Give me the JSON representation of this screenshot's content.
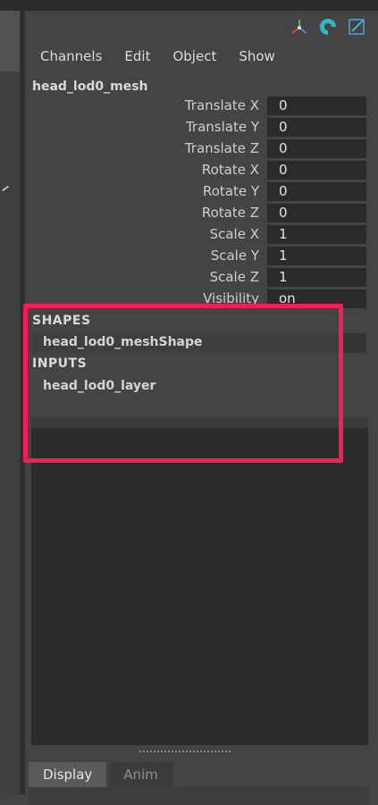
{
  "toolbar": {
    "icons": [
      "axis-tripod-icon",
      "refresh-icon",
      "edit-pencil-icon"
    ]
  },
  "menu": [
    "Channels",
    "Edit",
    "Object",
    "Show"
  ],
  "object_name": "head_lod0_mesh",
  "channels": [
    {
      "label": "Translate X",
      "value": "0"
    },
    {
      "label": "Translate Y",
      "value": "0"
    },
    {
      "label": "Translate Z",
      "value": "0"
    },
    {
      "label": "Rotate X",
      "value": "0"
    },
    {
      "label": "Rotate Y",
      "value": "0"
    },
    {
      "label": "Rotate Z",
      "value": "0"
    },
    {
      "label": "Scale X",
      "value": "1"
    },
    {
      "label": "Scale Y",
      "value": "1"
    },
    {
      "label": "Scale Z",
      "value": "1"
    },
    {
      "label": "Visibility",
      "value": "on"
    }
  ],
  "shapes": {
    "header": "SHAPES",
    "item": "head_lod0_meshShape"
  },
  "inputs": {
    "header": "INPUTS",
    "item": "head_lod0_layer"
  },
  "tabs": [
    "Display",
    "Anim"
  ],
  "colors": {
    "highlight": "#f51d5a",
    "panel_bg": "#444444",
    "field_bg": "#2b2b2b"
  }
}
